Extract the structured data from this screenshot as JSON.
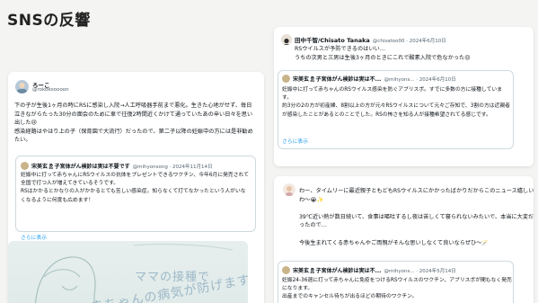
{
  "page": {
    "title": "SNSの反響"
  },
  "tweet_left": {
    "name": "ろーこ",
    "handle": "@rokokooooon",
    "text": "下の子が生後1ヶ月の時にRSに感染し入院→人工呼吸器手前まで悪化。生きた心地がせず、毎日泣きながらたった30分の面会のために車で往復2時間近くかけて通っていたあの辛い日々を思い出した😢\n感染経路はやはり上の子（保育園で大流行）だったので、第二子以降の妊娠中の方には是非勧めたい。",
    "quote": {
      "name": "宋美玄🎗子宮体がん検診は実は不要です",
      "handle": "@mihyonsong · 2024年11月14日",
      "text": "妊娠中に打って赤ちゃんにRSウイルスの抗体をプレゼントできるワクチン、今年6月に発売されて全国で打つ人が増えてきているそうです。\nRSはかかるとかなりの人がかかるとても苦しい感染症。知らなくて打てなかったという人がいなくなるように何度も広めます！",
      "showmore": "さらに表示"
    },
    "image_text_1": "ママの接種で",
    "image_text_2": "赤ちゃんの病気が防げます"
  },
  "tweet_right_top": {
    "name": "田中千智/Chisato Tanaka",
    "handle": "@chisatoo00 · 2024年6月10日",
    "text": "RSウイルスが予防できるのはいい…\nうちの次男と三男は生後3ヶ月のときにこれで酸素入院で危なかった😣",
    "quote": {
      "name": "宋美玄🎗子宮体がん検診は実は不...",
      "handle": "@mihyons... · 2024年6月10日",
      "text": "妊娠中に打って赤ちゃんのRSウイルス感染を防ぐアブリスボ。すでに多数の方に接種しています。\n約3分の2の方が初産婦、8割以上の方が元々RSウイルスについて元々ご存知で、3割の方は近親者が感染したことがあるとのことでした。RSの怖さを知る人が接種希望されてる感じです。",
      "showmore": "さらに表示"
    }
  },
  "tweet_right_bottom": {
    "text": "わー、タイムリーに最近親子ともどもRSウイルスにかかったばかりだからこのニュース嬉しいわ〜😭✨\n\n39℃近い熱が数日続いて、食事は嘔吐するし夜は苦しくて寝られないみたいで、本当に大変だったので…\n\n今後生まれてくる赤ちゃんやご両親がそんな思いしなくて良いならぜひ〜🪄",
    "quote": {
      "name": "宋美玄🎗子宮体がん検診は実は不...",
      "handle": "@mihyons... · 2024年5月14日",
      "text": "妊娠24-36週に打って赤ちゃんに免疫をつけるRSウイルスのワクチン、アブリスボが間もなく発売になります。\n出産までのキャンセル待ちが出るほどの期待のワクチン。"
    }
  },
  "colors": {
    "link": "#1d9bf0",
    "muted": "#536471",
    "background": "#f4f4f2"
  }
}
